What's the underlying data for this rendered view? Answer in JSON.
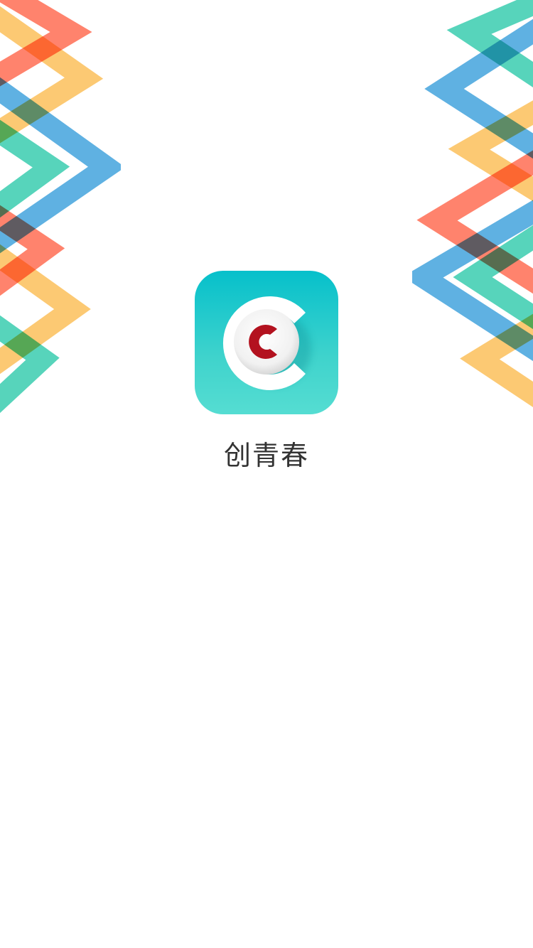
{
  "app": {
    "name": "创青春",
    "logo_icon": "c-logo-icon"
  },
  "colors": {
    "icon_gradient_top": "#06c0cb",
    "icon_gradient_bottom": "#55ddd2",
    "logo_accent": "#b3121f",
    "ribbon_red": "#ff5a3c",
    "ribbon_orange": "#fbb744",
    "ribbon_blue": "#2a97d8",
    "ribbon_green": "#1fc6a4",
    "text": "#333333"
  }
}
